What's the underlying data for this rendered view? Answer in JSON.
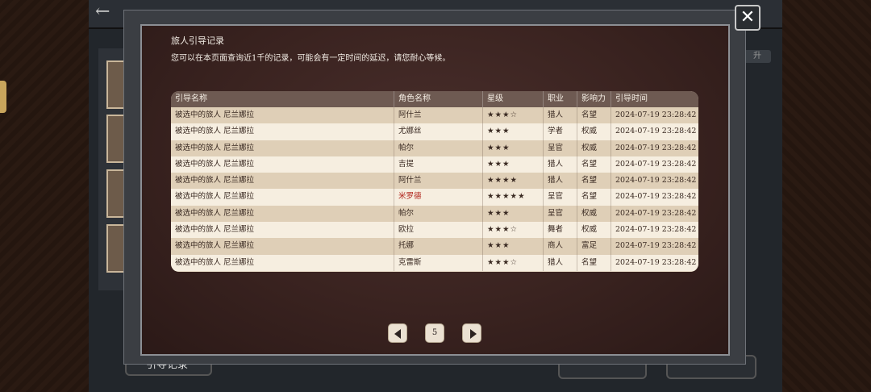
{
  "background": {
    "bottom_button_label": "引导记录",
    "upgrade_label": "升"
  },
  "dialog": {
    "title": "旅人引导记录",
    "description": "您可以在本页面查询近1千的记录，可能会有一定时间的延迟，请您耐心等候。",
    "close_label": "✕"
  },
  "table": {
    "headers": [
      "引导名称",
      "角色名称",
      "星级",
      "职业",
      "影响力",
      "引导时间"
    ],
    "rows": [
      {
        "guide": "被选中的旅人 尼兰娜拉",
        "char": "阿什兰",
        "stars": "★★★☆",
        "job": "猎人",
        "influence": "名望",
        "time": "2024-07-19 23:28:42"
      },
      {
        "guide": "被选中的旅人 尼兰娜拉",
        "char": "尤娜丝",
        "stars": "★★★",
        "job": "学者",
        "influence": "权威",
        "time": "2024-07-19 23:28:42"
      },
      {
        "guide": "被选中的旅人 尼兰娜拉",
        "char": "帕尔",
        "stars": "★★★",
        "job": "呈官",
        "influence": "权威",
        "time": "2024-07-19 23:28:42"
      },
      {
        "guide": "被选中的旅人 尼兰娜拉",
        "char": "吉提",
        "stars": "★★★",
        "job": "猎人",
        "influence": "名望",
        "time": "2024-07-19 23:28:42"
      },
      {
        "guide": "被选中的旅人 尼兰娜拉",
        "char": "阿什兰",
        "stars": "★★★★",
        "job": "猎人",
        "influence": "名望",
        "time": "2024-07-19 23:28:42"
      },
      {
        "guide": "被选中的旅人 尼兰娜拉",
        "char": "米罗德",
        "stars": "★★★★★",
        "job": "呈官",
        "influence": "名望",
        "time": "2024-07-19 23:28:42",
        "highlight": true
      },
      {
        "guide": "被选中的旅人 尼兰娜拉",
        "char": "帕尔",
        "stars": "★★★",
        "job": "呈官",
        "influence": "权威",
        "time": "2024-07-19 23:28:42"
      },
      {
        "guide": "被选中的旅人 尼兰娜拉",
        "char": "欧拉",
        "stars": "★★★☆",
        "job": "舞者",
        "influence": "权威",
        "time": "2024-07-19 23:28:42"
      },
      {
        "guide": "被选中的旅人 尼兰娜拉",
        "char": "托娜",
        "stars": "★★★",
        "job": "商人",
        "influence": "富足",
        "time": "2024-07-19 23:28:42"
      },
      {
        "guide": "被选中的旅人 尼兰娜拉",
        "char": "克雷斯",
        "stars": "★★★☆",
        "job": "猎人",
        "influence": "名望",
        "time": "2024-07-19 23:28:42"
      }
    ]
  },
  "pagination": {
    "current_page": "5"
  },
  "colors": {
    "highlight": "#b0241b",
    "table_header": "#6e5a52",
    "panel_bg": "#3a2320"
  }
}
